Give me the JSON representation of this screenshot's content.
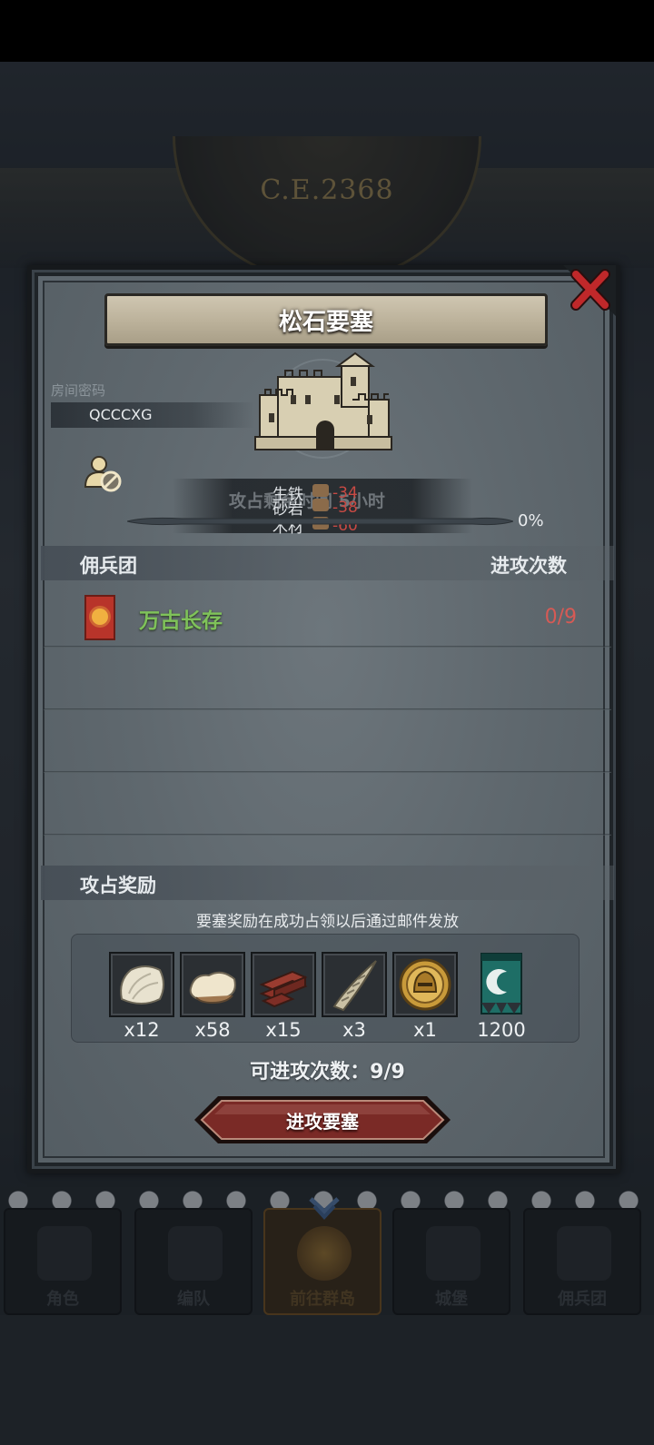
{
  "background": {
    "year": "C.E.2368",
    "nav_tabs": [
      {
        "label": "角色",
        "icon": "character-icon"
      },
      {
        "label": "编队",
        "icon": "formation-icon"
      },
      {
        "label": "前往群岛",
        "icon": "islands-icon"
      },
      {
        "label": "城堡",
        "icon": "castle-icon"
      },
      {
        "label": "佣兵团",
        "icon": "mercenary-icon"
      }
    ]
  },
  "dialog": {
    "title": "松石要塞",
    "room_password_label": "房间密码",
    "room_password_value": "QCCCXG",
    "timer": "攻占剩余时间 5小时",
    "production": [
      {
        "name": "生铁",
        "value": "-34"
      },
      {
        "name": "砂岩",
        "value": "-38"
      },
      {
        "name": "木材",
        "value": "-60"
      }
    ],
    "progress_percent": "0%",
    "progress_value": 0,
    "mercenary_header": "佣兵团",
    "attack_count_header": "进攻次数",
    "guilds": [
      {
        "name": "万古长存",
        "count": "0/9"
      }
    ],
    "reward_header": "攻占奖励",
    "reward_note": "要塞奖励在成功占领以后通过邮件发放",
    "rewards": [
      {
        "icon": "fur-pelt-icon",
        "qty": "x12"
      },
      {
        "icon": "wool-fleece-icon",
        "qty": "x58"
      },
      {
        "icon": "wood-planks-icon",
        "qty": "x15"
      },
      {
        "icon": "twisted-horn-icon",
        "qty": "x3"
      },
      {
        "icon": "gold-helmet-medal-icon",
        "qty": "x1"
      },
      {
        "icon": "guild-banner-icon",
        "qty": "1200"
      }
    ],
    "attempts_label": "可进攻次数：9/9",
    "attack_button": "进攻要塞"
  },
  "colors": {
    "accent_red": "#c84a44",
    "guild_green": "#7fc25a",
    "button_red": "#7a2a26",
    "close_red": "#c0282a"
  }
}
